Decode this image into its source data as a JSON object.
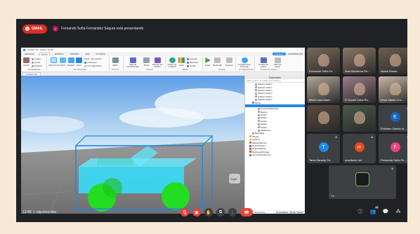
{
  "topbar": {
    "gmail_label": "GMAIL",
    "presenter_initial": "F",
    "presenter_text": "Fernando Sofía Fernández Segura está presentando"
  },
  "studio": {
    "window_title": "Untitled.rbxl - Roblox Studio",
    "menu_tabs": [
      "ARCHIVO",
      "INICIO",
      "MODELO",
      "PRUEBA",
      "VER",
      "PLUGINS"
    ],
    "active_tab": "INICIO",
    "collab_label": "Colaborar",
    "user_label": "Fer8459044413",
    "ribbon": {
      "clipboard_group": "Portapapeles",
      "paste": "Pegar",
      "copy": "Copiar",
      "cut": "Cortar",
      "duplicate": "Duplicar",
      "tools_group": "Herramientas",
      "select": "Seleccionar",
      "move": "Mover",
      "scale": "Escalar",
      "rotate": "Girar",
      "mode_label": "Modo:",
      "mode_value": "Geométrico",
      "collisions": "Colisiones",
      "join_surfaces": "Unir superficies",
      "terrain_group": "Terreno",
      "editor": "Editor",
      "insert_group": "Insertar",
      "toolbox": "Caja de herramientas",
      "part": "Pieza",
      "ui": "Interfaz de usuario",
      "edit_group": "Editar",
      "material": "Gestor de material",
      "color": "Color",
      "group": "Agrupar",
      "lock": "Bloquear",
      "anchor": "Anclar",
      "test_group": "Prueba",
      "play": "Jugar",
      "resume": "Reanudar",
      "stop": "Detener",
      "settings_group": "Configuraciones",
      "game_settings": "Configuración del juego",
      "team_test_group": "Prueba de equipo",
      "team_test": "Prueba de equipo",
      "leave_game": "Salir del juego"
    },
    "doc_tab": "Untitled.rbxl",
    "explorer": {
      "title": "Explorador",
      "filter_placeholder": "Filtrar espacio de trabajo (Ctrl+Shift+X)",
      "nodes": [
        {
          "label": "SpawnLocation",
          "indent": 3,
          "color": "#9e9e9e"
        },
        {
          "label": "SpawnLocation",
          "indent": 3,
          "color": "#9e9e9e"
        },
        {
          "label": "SpawnLocation",
          "indent": 3,
          "color": "#9e9e9e"
        },
        {
          "label": "SpawnLocation",
          "indent": 3,
          "color": "#9e9e9e"
        },
        {
          "label": "SpawnLocation",
          "indent": 3,
          "color": "#9e9e9e"
        },
        {
          "label": "SpawnLocation",
          "indent": 3,
          "color": "#9e9e9e"
        },
        {
          "label": "Model",
          "indent": 2,
          "color": "#607d8b"
        },
        {
          "label": "",
          "indent": 3,
          "color": "#607d8b",
          "selected": true
        },
        {
          "label": "HumanoidRootPart",
          "indent": 4,
          "color": "#9e9e9e"
        },
        {
          "label": "asiento",
          "indent": 4,
          "color": "#9e9e9e"
        },
        {
          "label": "chasis",
          "indent": 4,
          "color": "#9e9e9e"
        },
        {
          "label": "llanta1",
          "indent": 4,
          "color": "#9e9e9e"
        },
        {
          "label": "llanta2",
          "indent": 4,
          "color": "#9e9e9e"
        },
        {
          "label": "llanta3",
          "indent": 4,
          "color": "#9e9e9e"
        },
        {
          "label": "llanta4",
          "indent": 4,
          "color": "#9e9e9e"
        },
        {
          "label": "parabrisas",
          "indent": 4,
          "color": "#9e9e9e"
        },
        {
          "label": "Baseplate",
          "indent": 2,
          "color": "#9e9e9e"
        },
        {
          "label": "Players",
          "indent": 1,
          "color": "#f9a825"
        },
        {
          "label": "Lighting",
          "indent": 1,
          "color": "#fbc02d"
        },
        {
          "label": "MaterialService",
          "indent": 1,
          "color": "#8d6e63"
        },
        {
          "label": "NetworkClient",
          "indent": 1,
          "color": "#546e7a"
        },
        {
          "label": "ReplicatedFirst",
          "indent": 1,
          "color": "#e53935"
        },
        {
          "label": "ReplicatedStorage",
          "indent": 1,
          "color": "#e53935"
        },
        {
          "label": "ServerScriptService",
          "indent": 1,
          "color": "#43a047"
        }
      ],
      "footer_tabs": [
        "Explorador",
        "Propiedades - Model \"Model\""
      ]
    },
    "viewport_overlay": "Right"
  },
  "participants": [
    {
      "name": "Fernando Sofía Fe...",
      "kind": "video",
      "bg": "#7a6a5a"
    },
    {
      "name": "Ana Macarena Ro...",
      "kind": "video",
      "bg": "#8a7866"
    },
    {
      "name": "Alanis Rosas",
      "kind": "video",
      "bg": "#6d5f52"
    },
    {
      "name": "Mikel Luna Marti...",
      "kind": "video",
      "bg": "#b0a898"
    },
    {
      "name": "El Daniel Cuba Ro...",
      "kind": "video",
      "bg": "#9c7d86"
    },
    {
      "name": "Erica Varela Cru...",
      "kind": "video",
      "bg": "#c9b8a6"
    },
    {
      "name": "",
      "kind": "video",
      "bg": "#5a4a40"
    },
    {
      "name": "",
      "kind": "video",
      "bg": "#4a5a4a"
    },
    {
      "name": "Emiliano García m...",
      "kind": "avatar",
      "initial": "E",
      "color": "#1565c0"
    },
    {
      "name": "Tania Zaraoly Co...",
      "kind": "avatar",
      "initial": "T",
      "color": "#1e88e5"
    },
    {
      "name": "monitoreo rec",
      "kind": "avatar",
      "initial": "m",
      "color": "#e64a19"
    },
    {
      "name": "Fernanda Sofía Fe...",
      "kind": "avatar",
      "initial": "F",
      "color": "#ec407a"
    },
    {
      "name": "Tú",
      "kind": "self",
      "bg": "#3c4043"
    }
  ],
  "bottombar": {
    "time": "12:40",
    "separator": "|",
    "meeting_code": "oig-excz-dos",
    "participant_count": "15"
  },
  "colors": {
    "meet_bg": "#202124",
    "tile_bg": "#3c4043",
    "red": "#ea4335",
    "car_body": "#33e0ff",
    "car_wheels": "#22dd22"
  }
}
